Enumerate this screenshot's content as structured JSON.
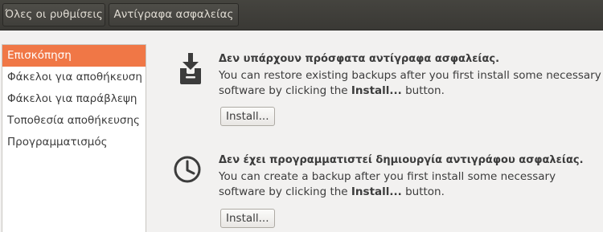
{
  "toolbar": {
    "all_settings_label": "Όλες οι ρυθμίσεις",
    "backups_label": "Αντίγραφα ασφαλείας"
  },
  "sidebar": {
    "items": [
      {
        "label": "Επισκόπηση",
        "active": true
      },
      {
        "label": "Φάκελοι για αποθήκευση",
        "active": false
      },
      {
        "label": "Φάκελοι για παράβλεψη",
        "active": false
      },
      {
        "label": "Τοποθεσία αποθήκευσης",
        "active": false
      },
      {
        "label": "Προγραμματισμός",
        "active": false
      }
    ]
  },
  "restore": {
    "icon": "inbox-download-icon",
    "title": "Δεν υπάρχουν πρόσφατα αντίγραφα ασφαλείας.",
    "desc_pre": "You can restore existing backups after you first install some necessary software by clicking the ",
    "desc_bold": "Install...",
    "desc_post": " button.",
    "button_label": "Install..."
  },
  "schedule": {
    "icon": "clock-icon",
    "title": "Δεν έχει προγραμματιστεί δημιουργία αντιγράφου ασφαλείας.",
    "desc_pre": "You can create a backup after you first install some necessary software by clicking the ",
    "desc_bold": "Install...",
    "desc_post": " button.",
    "button_label": "Install..."
  },
  "colors": {
    "accent": "#f07746",
    "toolbar_bg": "#3c3b37",
    "window_bg": "#f2f1f0"
  }
}
